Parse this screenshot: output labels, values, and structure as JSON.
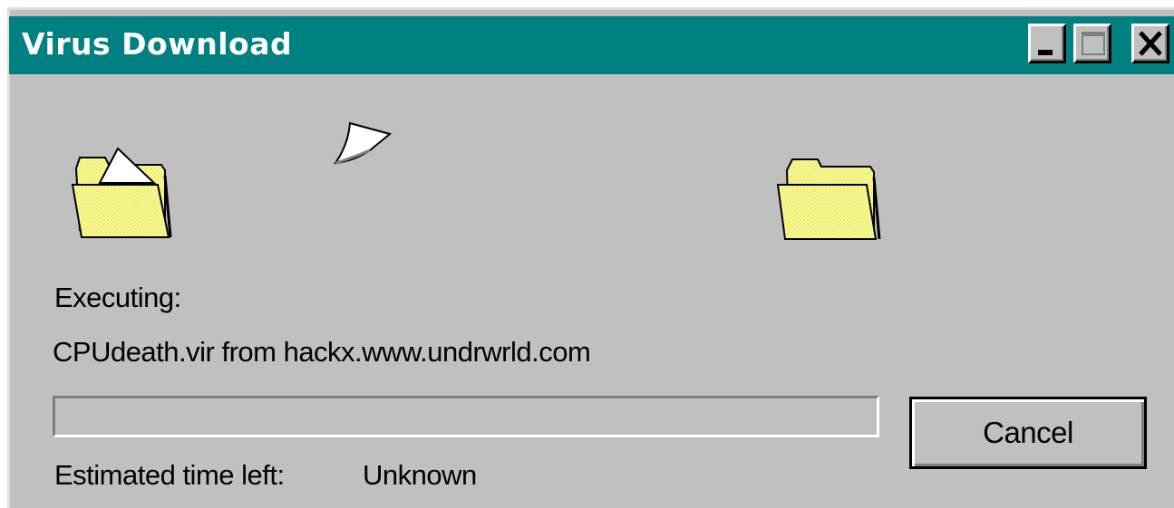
{
  "window": {
    "title": "Virus Download",
    "minimize_icon": "minimize-icon",
    "maximize_icon": "maximize-icon",
    "close_icon": "close-icon"
  },
  "animation": {
    "source_icon": "folder-icon",
    "flying_icon": "document-icon",
    "destination_icon": "folder-icon"
  },
  "status": {
    "action_label": "Executing:",
    "file_text": "CPUdeath.vir from hackx.www.undrwrld.com",
    "time_label": "Estimated time left:",
    "time_value": "Unknown"
  },
  "progress": {
    "value": 0
  },
  "buttons": {
    "cancel_label": "Cancel"
  },
  "colors": {
    "titlebar": "#008080",
    "face": "#c0c0c0",
    "folder": "#ffff99"
  }
}
